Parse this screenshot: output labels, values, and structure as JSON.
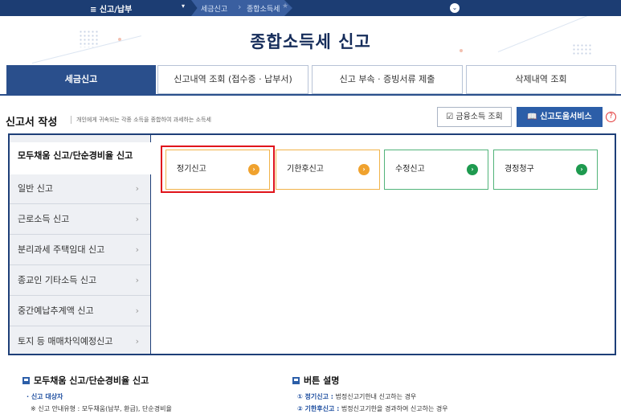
{
  "topnav": {
    "menu_label": "≡ 신고/납부",
    "caret": "▾",
    "crumb1": "세금신고",
    "crumb2": "종합소득세",
    "star": "★",
    "circle_icon": "⌄"
  },
  "banner": {
    "title": "종합소득세 신고"
  },
  "tabs": [
    {
      "label": "세금신고"
    },
    {
      "label": "신고내역 조회 (접수증 · 납부서)"
    },
    {
      "label": "신고 부속 · 증빙서류 제출"
    },
    {
      "label": "삭제내역 조회"
    }
  ],
  "section": {
    "title": "신고서 작성",
    "description": "개인에게 귀속되는 각종 소득을 종합하여 과세하는 소득세",
    "btn_financial": "☑ 금융소득 조회",
    "btn_help": "📖 신고도움서비스",
    "help_mark": "?"
  },
  "sidemenu": [
    {
      "label": "모두채움 신고/단순경비율 신고"
    },
    {
      "label": "일반 신고"
    },
    {
      "label": "근로소득 신고"
    },
    {
      "label": "분리과세 주택임대 신고"
    },
    {
      "label": "종교인 기타소득 신고"
    },
    {
      "label": "중간예납추계액 신고"
    },
    {
      "label": "토지 등 매매차익예정신고"
    }
  ],
  "chevron": "›",
  "cards": [
    {
      "label": "정기신고",
      "icon": "›"
    },
    {
      "label": "기한후신고",
      "icon": "›"
    },
    {
      "label": "수정신고",
      "icon": "›"
    },
    {
      "label": "경정청구",
      "icon": "›"
    }
  ],
  "desc": {
    "left_title": "모두채움 신고/단순경비율 신고",
    "left_line1": "· 신고 대상자",
    "left_line2": "※ 신고 안내유형 : 모두채움(납부, 환급), 단순경비율",
    "right_title": "버튼 설명",
    "right_line1_key": "① 정기신고 :",
    "right_line1_val": " 법정신고기한내 신고하는 경우",
    "right_line2_key": "② 기한후신고 :",
    "right_line2_val": " 법정신고기한을 경과하여 신고하는 경우"
  }
}
